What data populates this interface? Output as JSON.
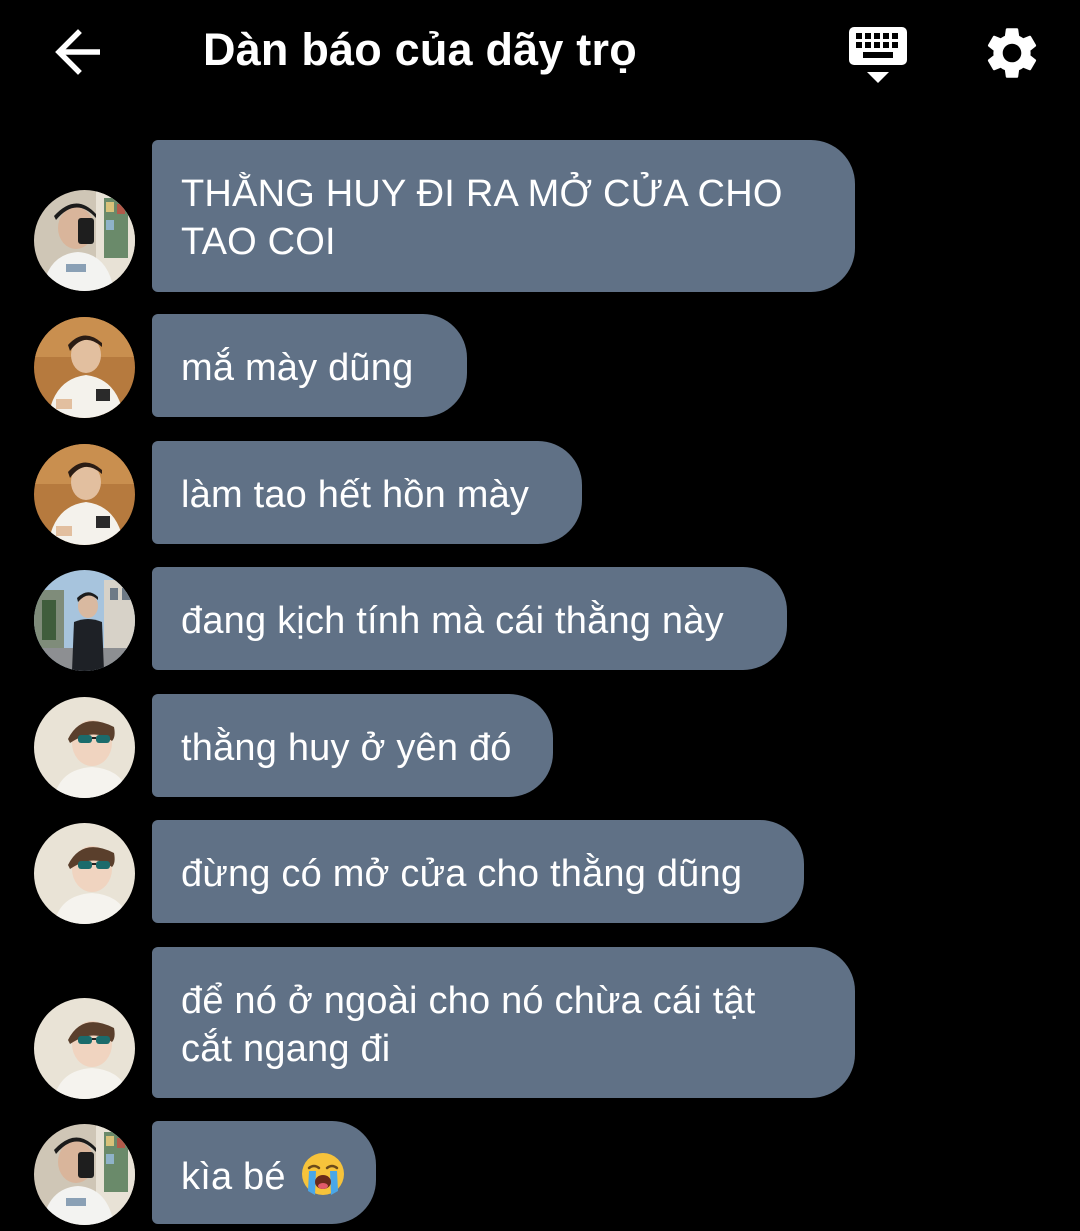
{
  "header": {
    "title": "Dàn báo của dãy trọ",
    "back_icon": "arrow-left-icon",
    "keyboard_icon": "keyboard-icon",
    "settings_icon": "gear-icon"
  },
  "colors": {
    "background": "#000000",
    "bubble": "#607186",
    "text": "#ffffff"
  },
  "messages": [
    {
      "lines": [
        "THẰNG HUY ĐI RA MỞ CỬA CHO",
        "TAO COI"
      ],
      "avatar": "avatar-mirror-selfie"
    },
    {
      "lines": [
        "mắ mày dũng"
      ],
      "avatar": "avatar-sitting-warm"
    },
    {
      "lines": [
        "làm tao hết hồn mày"
      ],
      "avatar": "avatar-sitting-warm"
    },
    {
      "lines": [
        "đang kịch tính mà cái thằng này"
      ],
      "avatar": "avatar-street"
    },
    {
      "lines": [
        "thằng huy ở yên đó"
      ],
      "avatar": "avatar-sunglasses"
    },
    {
      "lines": [
        "đừng có mở cửa cho thằng dũng"
      ],
      "avatar": "avatar-sunglasses"
    },
    {
      "lines": [
        "để nó ở ngoài cho nó chừa cái tật",
        "cắt ngang đi"
      ],
      "avatar": "avatar-sunglasses"
    },
    {
      "lines": [
        "kìa bé"
      ],
      "emoji": "loudly-crying-face-icon",
      "avatar": "avatar-mirror-selfie"
    }
  ]
}
